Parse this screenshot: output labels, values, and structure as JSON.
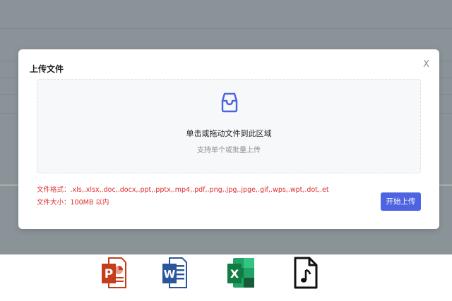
{
  "modal": {
    "title": "上传文件",
    "close_label": "X",
    "dropzone": {
      "icon": "inbox-icon",
      "main_text": "单击或拖动文件到此区域",
      "hint_text": "支持单个或批量上传"
    },
    "formats_text": "文件格式：.xls,.xlsx,.doc,.docx,.ppt,.pptx,.mp4,.pdf,.png,.jpg,.jpge,.gif,.wps,.wpt,.dot,.et",
    "size_text": "文件大小：100MB 以内",
    "upload_button_label": "开始上传"
  },
  "file_types": {
    "ppt": {
      "letter": "P",
      "icon": "powerpoint-icon"
    },
    "word": {
      "letter": "W",
      "icon": "word-icon"
    },
    "excel": {
      "letter": "X",
      "icon": "excel-icon"
    },
    "audio": {
      "icon": "audio-file-icon"
    }
  },
  "colors": {
    "overlay": "#8a9398",
    "accent": "#4e63e0",
    "warning_text": "#e02b2b",
    "ppt": "#c43e1c",
    "word": "#2b579a",
    "excel": "#1f9e4b"
  }
}
